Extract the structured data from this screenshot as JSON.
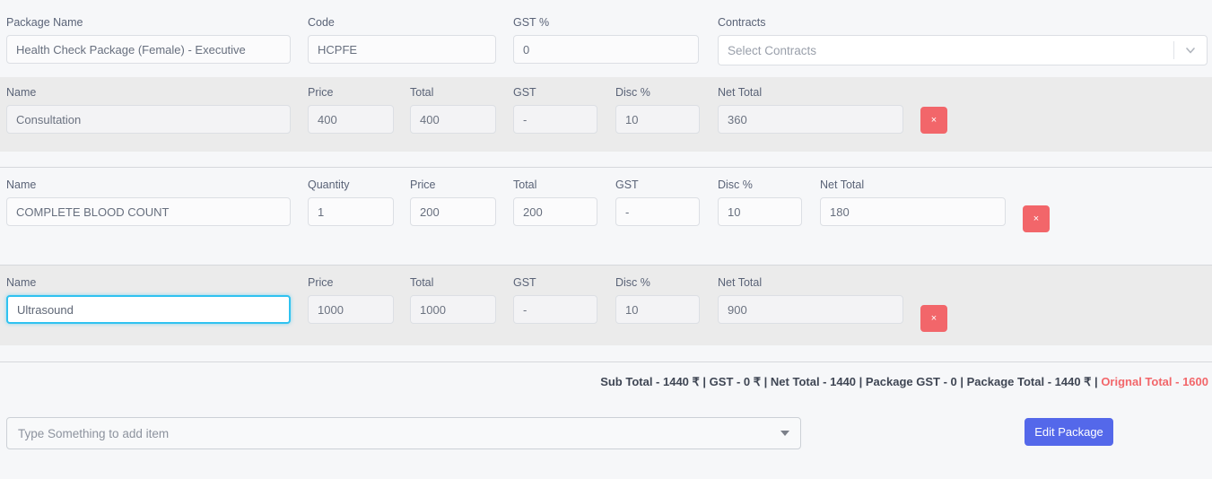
{
  "top": {
    "package_name": {
      "label": "Package Name",
      "value": "Health Check Package (Female) - Executive"
    },
    "code": {
      "label": "Code",
      "value": "HCPFE"
    },
    "gst_percent": {
      "label": "GST %",
      "value": "0"
    },
    "contracts": {
      "label": "Contracts",
      "placeholder": "Select Contracts"
    }
  },
  "rows": [
    {
      "name": {
        "label": "Name",
        "value": "Consultation"
      },
      "price": {
        "label": "Price",
        "value": "400"
      },
      "total": {
        "label": "Total",
        "value": "400"
      },
      "gst": {
        "label": "GST",
        "value": "-"
      },
      "disc": {
        "label": "Disc %",
        "value": "10"
      },
      "net_total": {
        "label": "Net Total",
        "value": "360"
      },
      "delete_label": "×"
    },
    {
      "name": {
        "label": "Name",
        "value": "COMPLETE BLOOD COUNT"
      },
      "quantity": {
        "label": "Quantity",
        "value": "1"
      },
      "price": {
        "label": "Price",
        "value": "200"
      },
      "total": {
        "label": "Total",
        "value": "200"
      },
      "gst": {
        "label": "GST",
        "value": "-"
      },
      "disc": {
        "label": "Disc %",
        "value": "10"
      },
      "net_total": {
        "label": "Net Total",
        "value": "180"
      },
      "delete_label": "×"
    },
    {
      "name": {
        "label": "Name",
        "value": "Ultrasound"
      },
      "price": {
        "label": "Price",
        "value": "1000"
      },
      "total": {
        "label": "Total",
        "value": "1000"
      },
      "gst": {
        "label": "GST",
        "value": "-"
      },
      "disc": {
        "label": "Disc %",
        "value": "10"
      },
      "net_total": {
        "label": "Net Total",
        "value": "900"
      },
      "delete_label": "×"
    }
  ],
  "summary": {
    "main": "Sub Total - 1440 ₹ | GST - 0 ₹ | Net Total - 1440 | Package GST - 0 | Package Total - 1440 ₹ | ",
    "original": "Orignal Total - 1600"
  },
  "footer": {
    "add_item_placeholder": "Type Something to add item",
    "edit_button_label": "Edit Package"
  },
  "colors": {
    "accent": "#5468ea",
    "danger": "#f2666a",
    "focus": "#2fc2f0",
    "row_shaded": "#ebebeb",
    "page_bg": "#f6f7f9"
  }
}
